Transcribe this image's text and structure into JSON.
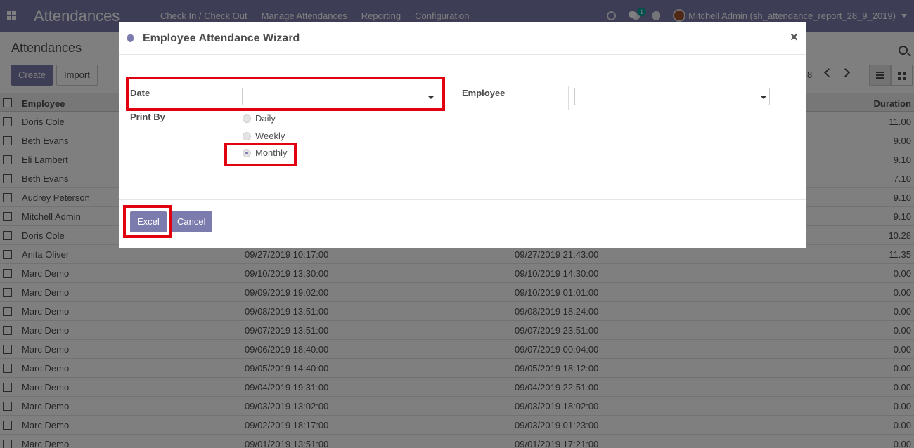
{
  "navbar": {
    "brand": "Attendances",
    "menu": [
      "Check In / Check Out",
      "Manage Attendances",
      "Reporting",
      "Configuration"
    ],
    "chat_badge": "1",
    "user": "Mitchell Admin (sh_attendance_report_28_9_2019)"
  },
  "control_panel": {
    "title": "Attendances",
    "create_label": "Create",
    "import_label": "Import",
    "pager_text": "8"
  },
  "list": {
    "headers": {
      "employee": "Employee",
      "duration": "Duration"
    },
    "rows": [
      {
        "employee": "Doris Cole",
        "check_in": "",
        "check_out": "",
        "duration": "11.00"
      },
      {
        "employee": "Beth Evans",
        "check_in": "",
        "check_out": "",
        "duration": "9.00"
      },
      {
        "employee": "Eli Lambert",
        "check_in": "",
        "check_out": "",
        "duration": "9.10"
      },
      {
        "employee": "Beth Evans",
        "check_in": "",
        "check_out": "",
        "duration": "7.10"
      },
      {
        "employee": "Audrey Peterson",
        "check_in": "",
        "check_out": "",
        "duration": "9.10"
      },
      {
        "employee": "Mitchell Admin",
        "check_in": "",
        "check_out": "",
        "duration": "9.10"
      },
      {
        "employee": "Doris Cole",
        "check_in": "",
        "check_out": "",
        "duration": "10.28"
      },
      {
        "employee": "Anita Oliver",
        "check_in": "09/27/2019 10:17:00",
        "check_out": "09/27/2019 21:43:00",
        "duration": "11.35"
      },
      {
        "employee": "Marc Demo",
        "check_in": "09/10/2019 13:30:00",
        "check_out": "09/10/2019 14:30:00",
        "duration": "0.00"
      },
      {
        "employee": "Marc Demo",
        "check_in": "09/09/2019 19:02:00",
        "check_out": "09/10/2019 01:01:00",
        "duration": "0.00"
      },
      {
        "employee": "Marc Demo",
        "check_in": "09/08/2019 13:51:00",
        "check_out": "09/08/2019 18:24:00",
        "duration": "0.00"
      },
      {
        "employee": "Marc Demo",
        "check_in": "09/07/2019 13:51:00",
        "check_out": "09/07/2019 23:51:00",
        "duration": "0.00"
      },
      {
        "employee": "Marc Demo",
        "check_in": "09/06/2019 18:40:00",
        "check_out": "09/07/2019 00:04:00",
        "duration": "0.00"
      },
      {
        "employee": "Marc Demo",
        "check_in": "09/05/2019 14:40:00",
        "check_out": "09/05/2019 18:12:00",
        "duration": "0.00"
      },
      {
        "employee": "Marc Demo",
        "check_in": "09/04/2019 19:31:00",
        "check_out": "09/04/2019 22:51:00",
        "duration": "0.00"
      },
      {
        "employee": "Marc Demo",
        "check_in": "09/03/2019 13:02:00",
        "check_out": "09/03/2019 18:02:00",
        "duration": "0.00"
      },
      {
        "employee": "Marc Demo",
        "check_in": "09/02/2019 18:17:00",
        "check_out": "09/03/2019 01:23:00",
        "duration": "0.00"
      },
      {
        "employee": "Marc Demo",
        "check_in": "09/01/2019 13:51:00",
        "check_out": "09/01/2019 17:21:00",
        "duration": "0.00"
      }
    ]
  },
  "modal": {
    "title": "Employee Attendance Wizard",
    "close_symbol": "×",
    "date_label": "Date",
    "date_value": "",
    "employee_label": "Employee",
    "employee_value": "",
    "print_by_label": "Print By",
    "print_options": [
      "Daily",
      "Weekly",
      "Monthly"
    ],
    "print_selected": "Monthly",
    "excel_label": "Excel",
    "cancel_label": "Cancel"
  },
  "colors": {
    "primary": "#7c7bad",
    "highlight": "#e0000f"
  }
}
